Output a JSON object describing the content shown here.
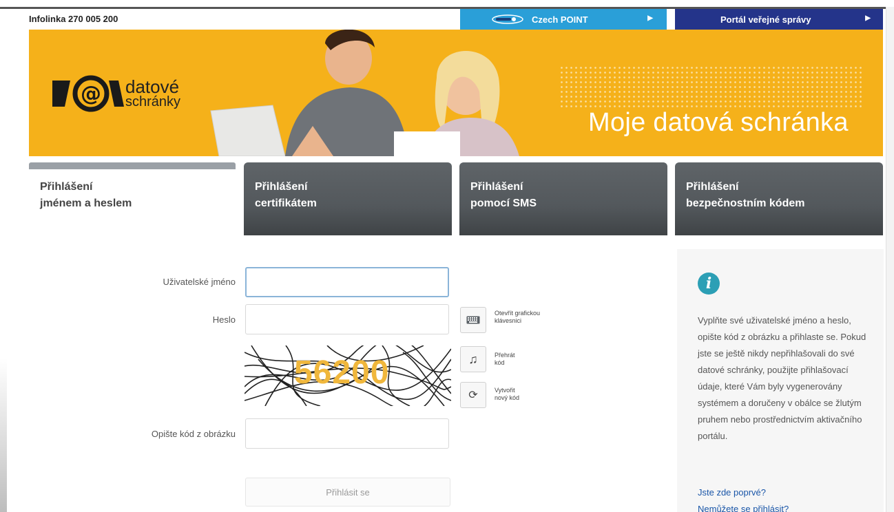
{
  "topbar": {
    "infoline": "Infolinka 270 005 200",
    "czech_point": "Czech POINT",
    "portal": "Portál veřejné správy"
  },
  "banner": {
    "logo_line1": "datové",
    "logo_line2": "schránky",
    "tagline": "Moje datová schránka"
  },
  "tabs": [
    {
      "label": "Přihlášení\njménem a heslem",
      "active": true
    },
    {
      "label": "Přihlášení\ncertifikátem",
      "active": false
    },
    {
      "label": "Přihlášení\npomocí SMS",
      "active": false
    },
    {
      "label": "Přihlášení\nbezpečnostním kódem",
      "active": false
    }
  ],
  "form": {
    "username_label": "Uživatelské jméno",
    "username_value": "",
    "password_label": "Heslo",
    "password_value": "",
    "captcha_code": "56200",
    "captcha_label": "Opište kód z obrázku",
    "captcha_value": "",
    "keyboard_caption": "Otevřít grafickou\nklávesnici",
    "play_caption": "Přehrát\nkód",
    "refresh_caption": "Vytvořit\nnový kód",
    "submit_label": "Přihlásit se"
  },
  "info": {
    "text": "Vyplňte své uživatelské jméno a heslo, opište kód z obrázku a přihlaste se. Pokud jste se ještě nikdy nepřihlašovali do své datové schránky, použijte přihlašovací údaje, které Vám byly vygenerovány systémem a doručeny v obálce se žlutým pruhem nebo prostřednictvím aktivačního portálu.",
    "link_first": "Jste zde poprvé?",
    "link_cannot": "Nemůžete se přihlásit?"
  },
  "colors": {
    "banner": "#f5b11a",
    "czech_point": "#2a9fd8",
    "portal": "#24348a",
    "tab_dark": "#53585c",
    "info_icon": "#2c9fb5",
    "link": "#1a56a8"
  }
}
